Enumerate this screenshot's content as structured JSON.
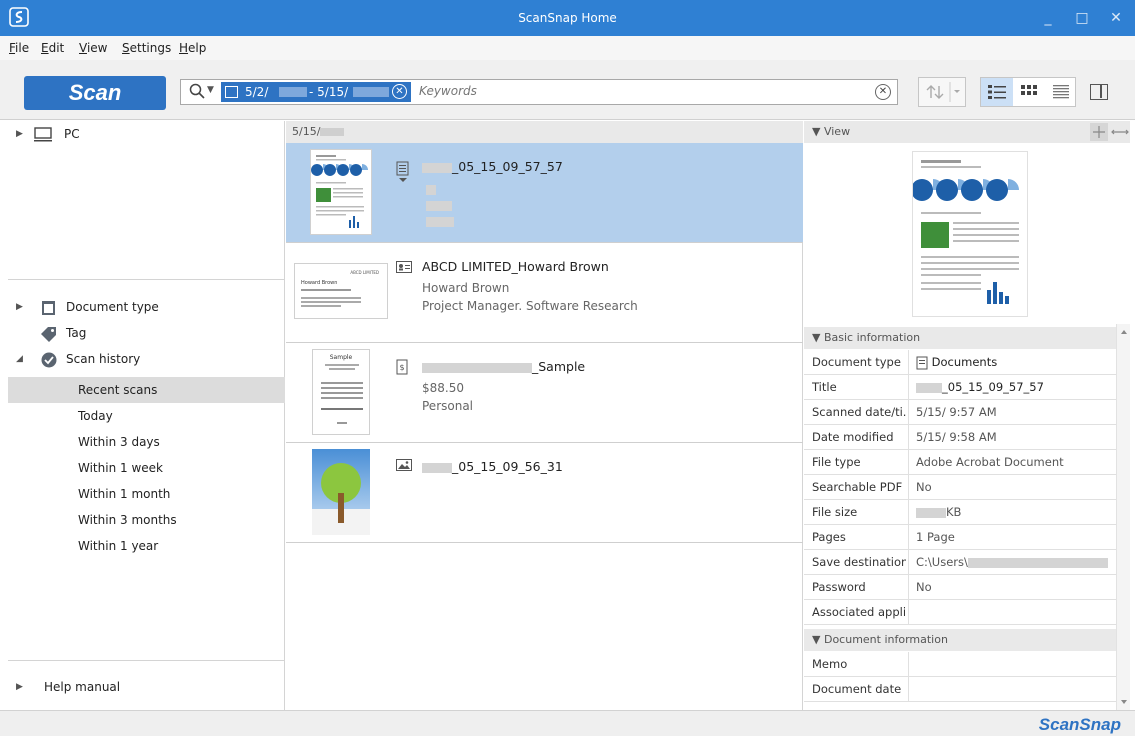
{
  "window": {
    "title": "ScanSnap Home",
    "minimize": "_",
    "maximize": "□",
    "close": "✕"
  },
  "menu": [
    "File",
    "Edit",
    "View",
    "Settings",
    "Help"
  ],
  "toolbar": {
    "scan_label": "Scan",
    "date_from": "5/2/",
    "date_to": "- 5/15/",
    "keywords_placeholder": "Keywords"
  },
  "left": {
    "pc_label": "PC",
    "document_type": "Document type",
    "tag": "Tag",
    "scan_history": "Scan history",
    "history_items": [
      "Recent scans",
      "Today",
      "Within 3 days",
      "Within 1 week",
      "Within 1 month",
      "Within 3 months",
      "Within 1 year"
    ],
    "help_manual": "Help manual"
  },
  "list": {
    "group_date": "5/15/",
    "items": [
      {
        "title_suffix": "_05_15_09_57_57"
      },
      {
        "title": "ABCD LIMITED_Howard Brown",
        "line1": "Howard Brown",
        "line2": "Project Manager. Software Research"
      },
      {
        "title_suffix": "_Sample",
        "line1": "$88.50",
        "line2": "Personal"
      },
      {
        "title_suffix": "_05_15_09_56_31"
      }
    ]
  },
  "thumbs": {
    "card_company": "ABCD LIMITED",
    "card_name": "Howard Brown",
    "receipt_title": "Sample"
  },
  "right": {
    "view_header": "View",
    "basic_header": "Basic information",
    "doc_info_header": "Document information",
    "basic": [
      {
        "k": "Document type",
        "v": "Documents"
      },
      {
        "k": "Title",
        "v": "_05_15_09_57_57"
      },
      {
        "k": "Scanned date/ti...",
        "v": "5/15/ 9:57 AM"
      },
      {
        "k": "Date modified",
        "v": "5/15/ 9:58 AM"
      },
      {
        "k": "File type",
        "v": "Adobe Acrobat Document"
      },
      {
        "k": "Searchable PDF",
        "v": "No"
      },
      {
        "k": "File size",
        "v": "KB"
      },
      {
        "k": "Pages",
        "v": "1 Page"
      },
      {
        "k": "Save destination",
        "v": "C:\\Users\\"
      },
      {
        "k": "Password",
        "v": "No"
      },
      {
        "k": "Associated appli...",
        "v": ""
      }
    ],
    "docinfo": [
      {
        "k": "Memo",
        "v": ""
      },
      {
        "k": "Document date",
        "v": ""
      }
    ]
  },
  "status": {
    "brand": "ScanSnap"
  },
  "colors": {
    "accent": "#2e73c3",
    "titlebar": "#2f80d3",
    "selected_row": "#b3cfec"
  }
}
